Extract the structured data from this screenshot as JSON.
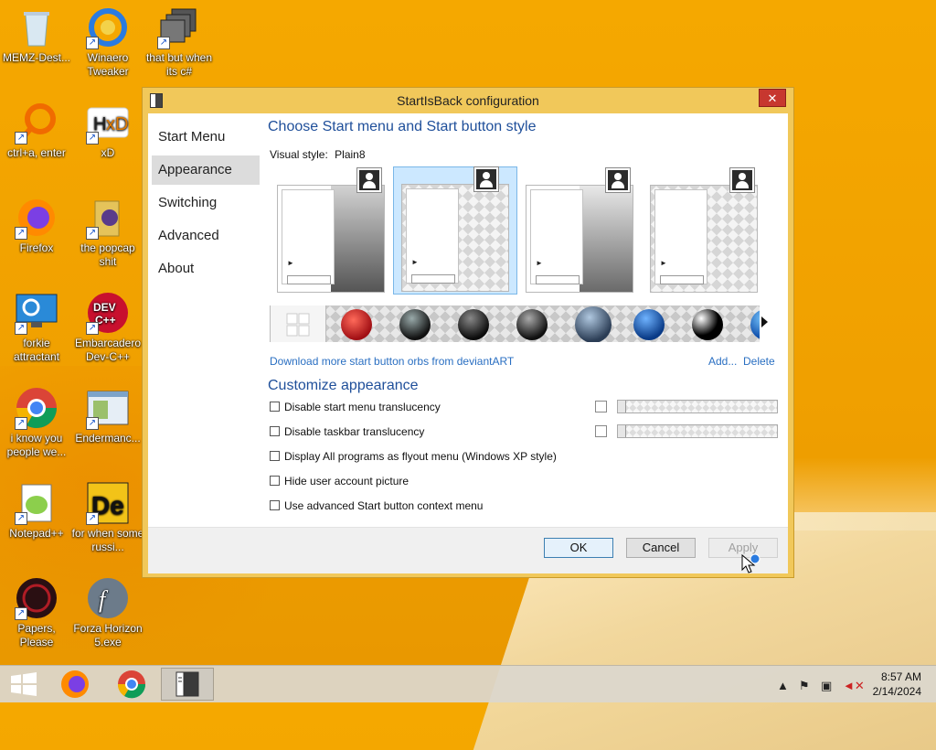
{
  "desktop": {
    "icons": [
      {
        "label": "MEMZ-Dest...",
        "icon": "recycle-bin-icon"
      },
      {
        "label": "Winaero Tweaker",
        "icon": "winaero-tweaker-icon"
      },
      {
        "label": "that but when its c#",
        "icon": "stacked-windows-icon"
      },
      {
        "label": "ctrl+a, enter",
        "icon": "search-ring-icon"
      },
      {
        "label": "xD",
        "icon": "hxd-icon"
      },
      {
        "label": "Firefox",
        "icon": "firefox-icon"
      },
      {
        "label": "the popcap shit",
        "icon": "folder-icon"
      },
      {
        "label": "forkie attractant",
        "icon": "monitor-gear-icon"
      },
      {
        "label": "Embarcadero Dev-C++",
        "icon": "devcpp-icon"
      },
      {
        "label": "i know you people we...",
        "icon": "chrome-icon"
      },
      {
        "label": "Endermanc...",
        "icon": "window-app-icon"
      },
      {
        "label": "Notepad++",
        "icon": "notepadpp-icon"
      },
      {
        "label": "for when some russi...",
        "icon": "de-app-icon"
      },
      {
        "label": "Papers, Please",
        "icon": "papers-please-icon"
      },
      {
        "label": "Forza Horizon 5.exe",
        "icon": "flash-icon"
      }
    ]
  },
  "dialog": {
    "title": "StartIsBack configuration",
    "close_glyph": "✕",
    "nav": [
      "Start Menu",
      "Appearance",
      "Switching",
      "Advanced",
      "About"
    ],
    "active_nav": "Appearance",
    "style_section_title": "Choose Start menu and Start button style",
    "visual_style_label": "Visual style:",
    "visual_style_value": "Plain8",
    "selected_style_index": 1,
    "download_link": "Download more start button orbs from deviantART",
    "add_link": "Add...",
    "delete_link": "Delete",
    "customize_title": "Customize appearance",
    "options": [
      {
        "label": "Disable start menu translucency",
        "checked": false
      },
      {
        "label": "Disable taskbar translucency",
        "checked": false
      },
      {
        "label": "Display All programs as flyout menu (Windows XP style)",
        "checked": false
      },
      {
        "label": "Hide user account picture",
        "checked": false
      },
      {
        "label": "Use advanced Start button context menu",
        "checked": false
      }
    ],
    "buttons": {
      "ok": "OK",
      "cancel": "Cancel",
      "apply": "Apply"
    }
  },
  "taskbar": {
    "items": [
      "start-button",
      "firefox-icon",
      "chrome-icon",
      "startisback-config-icon"
    ],
    "time": "8:57 AM",
    "date": "2/14/2024"
  },
  "colors": {
    "accent_title": "#1f4f9a",
    "link": "#2a6fc2",
    "window_frame": "#f1c85a",
    "close_red": "#c7372f",
    "desktop": "#f5a800"
  }
}
